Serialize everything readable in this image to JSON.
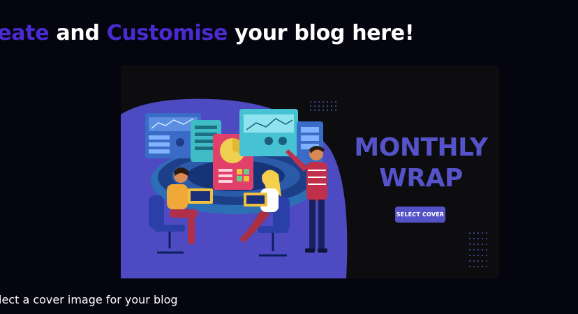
{
  "headline": {
    "part1": "Create",
    "part2": " and ",
    "part3": "Customise",
    "part4": " your blog here!",
    "accent_color": "#4a2bd0"
  },
  "cover": {
    "title_line1": "MONTHLY",
    "title_line2": "WRAP",
    "select_button_label": "SELECT COVER",
    "title_color": "#5553c9",
    "button_color": "#5552c8",
    "illustration": "team-meeting-dashboard-illustration"
  },
  "subtext": "Select a cover image for your blog"
}
